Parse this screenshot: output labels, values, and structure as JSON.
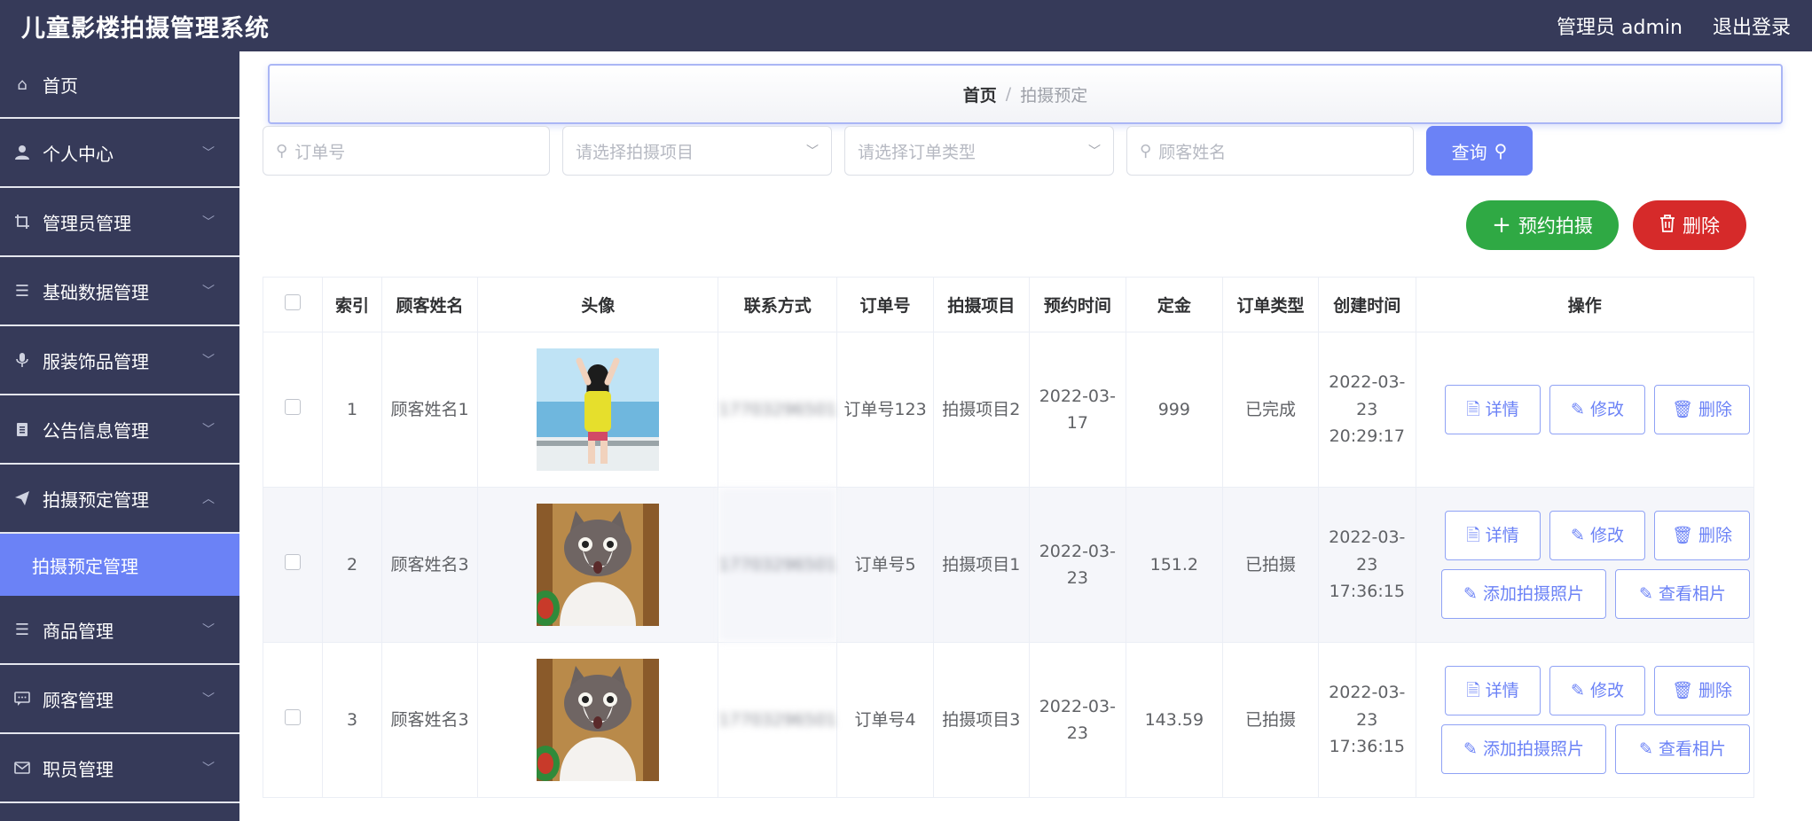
{
  "header": {
    "title": "儿童影楼拍摄管理系统",
    "user": "管理员 admin",
    "logout": "退出登录"
  },
  "sidebar": {
    "items": [
      {
        "label": "首页",
        "icon": "home-icon"
      },
      {
        "label": "个人中心",
        "icon": "user-icon"
      },
      {
        "label": "管理员管理",
        "icon": "crop-icon"
      },
      {
        "label": "基础数据管理",
        "icon": "list-icon"
      },
      {
        "label": "服装饰品管理",
        "icon": "mic-icon"
      },
      {
        "label": "公告信息管理",
        "icon": "clipboard-icon"
      },
      {
        "label": "拍摄预定管理",
        "icon": "send-icon"
      },
      {
        "label": "商品管理",
        "icon": "list-icon"
      },
      {
        "label": "顾客管理",
        "icon": "message-icon"
      },
      {
        "label": "职员管理",
        "icon": "mail-icon"
      }
    ],
    "active_sub": "拍摄预定管理"
  },
  "breadcrumb": {
    "home": "首页",
    "separator": "/",
    "current": "拍摄预定"
  },
  "search": {
    "order_placeholder": "订单号",
    "project_placeholder": "请选择拍摄项目",
    "type_placeholder": "请选择订单类型",
    "name_placeholder": "顾客姓名",
    "query_label": "查询"
  },
  "actions": {
    "add_label": "预约拍摄",
    "delete_label": "删除"
  },
  "table": {
    "headers": [
      "索引",
      "顾客姓名",
      "头像",
      "联系方式",
      "订单号",
      "拍摄项目",
      "预约时间",
      "定金",
      "订单类型",
      "创建时间",
      "操作"
    ],
    "rows": [
      {
        "index": "1",
        "name": "顾客姓名1",
        "phone": "17703296501",
        "order": "订单号123",
        "project": "拍摄项目2",
        "time": "2022-03-17",
        "deposit": "999",
        "type": "已完成",
        "created": "2022-03-23 20:29:17"
      },
      {
        "index": "2",
        "name": "顾客姓名3",
        "phone": "17703296501",
        "order": "订单号5",
        "project": "拍摄项目1",
        "time": "2022-03-23",
        "deposit": "151.2",
        "type": "已拍摄",
        "created": "2022-03-23 17:36:15"
      },
      {
        "index": "3",
        "name": "顾客姓名3",
        "phone": "17703296501",
        "order": "订单号4",
        "project": "拍摄项目3",
        "time": "2022-03-23",
        "deposit": "143.59",
        "type": "已拍摄",
        "created": "2022-03-23 17:36:15"
      }
    ],
    "op_labels": {
      "detail": "详情",
      "edit": "修改",
      "delete": "删除",
      "add_photo": "添加拍摄照片",
      "view_photo": "查看相片"
    }
  },
  "colors": {
    "nav": "#363a59",
    "accent": "#6b82f6",
    "success": "#2fa944",
    "danger": "#d62a2a"
  }
}
